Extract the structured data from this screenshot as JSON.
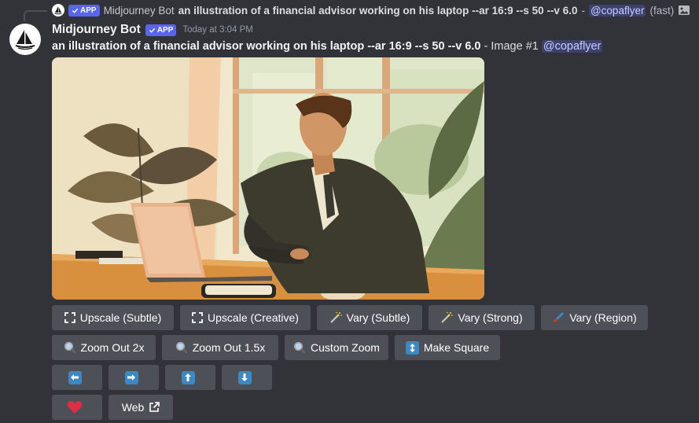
{
  "reply": {
    "author": "Midjourney Bot",
    "badge": "APP",
    "prompt": "an illustration of a financial advisor working on his laptop --ar 16:9 --s 50 --v 6.0",
    "separator": "-",
    "mention": "@copaflyer",
    "speed": "(fast)"
  },
  "message": {
    "author": "Midjourney Bot",
    "badge": "APP",
    "timestamp": "Today at 3:04 PM",
    "prompt": "an illustration of a financial advisor working on his laptop --ar 16:9 --s 50 --v 6.0",
    "suffix": "- Image #1",
    "mention": "@copaflyer"
  },
  "image": {
    "subject": "illustration of a financial advisor working on his laptop"
  },
  "buttons": {
    "upscale_subtle": "Upscale (Subtle)",
    "upscale_creative": "Upscale (Creative)",
    "vary_subtle": "Vary (Subtle)",
    "vary_strong": "Vary (Strong)",
    "vary_region": "Vary (Region)",
    "zoom_out_2x": "Zoom Out 2x",
    "zoom_out_1_5x": "Zoom Out 1.5x",
    "custom_zoom": "Custom Zoom",
    "make_square": "Make Square",
    "pan_left": "",
    "pan_right": "",
    "pan_up": "",
    "pan_down": "",
    "favorite": "",
    "web": "Web"
  },
  "colors": {
    "background": "#313338",
    "button": "#4e5058",
    "brand": "#5865f2",
    "arrow_blue": "#3b88c3",
    "heart": "#dd2e44"
  }
}
